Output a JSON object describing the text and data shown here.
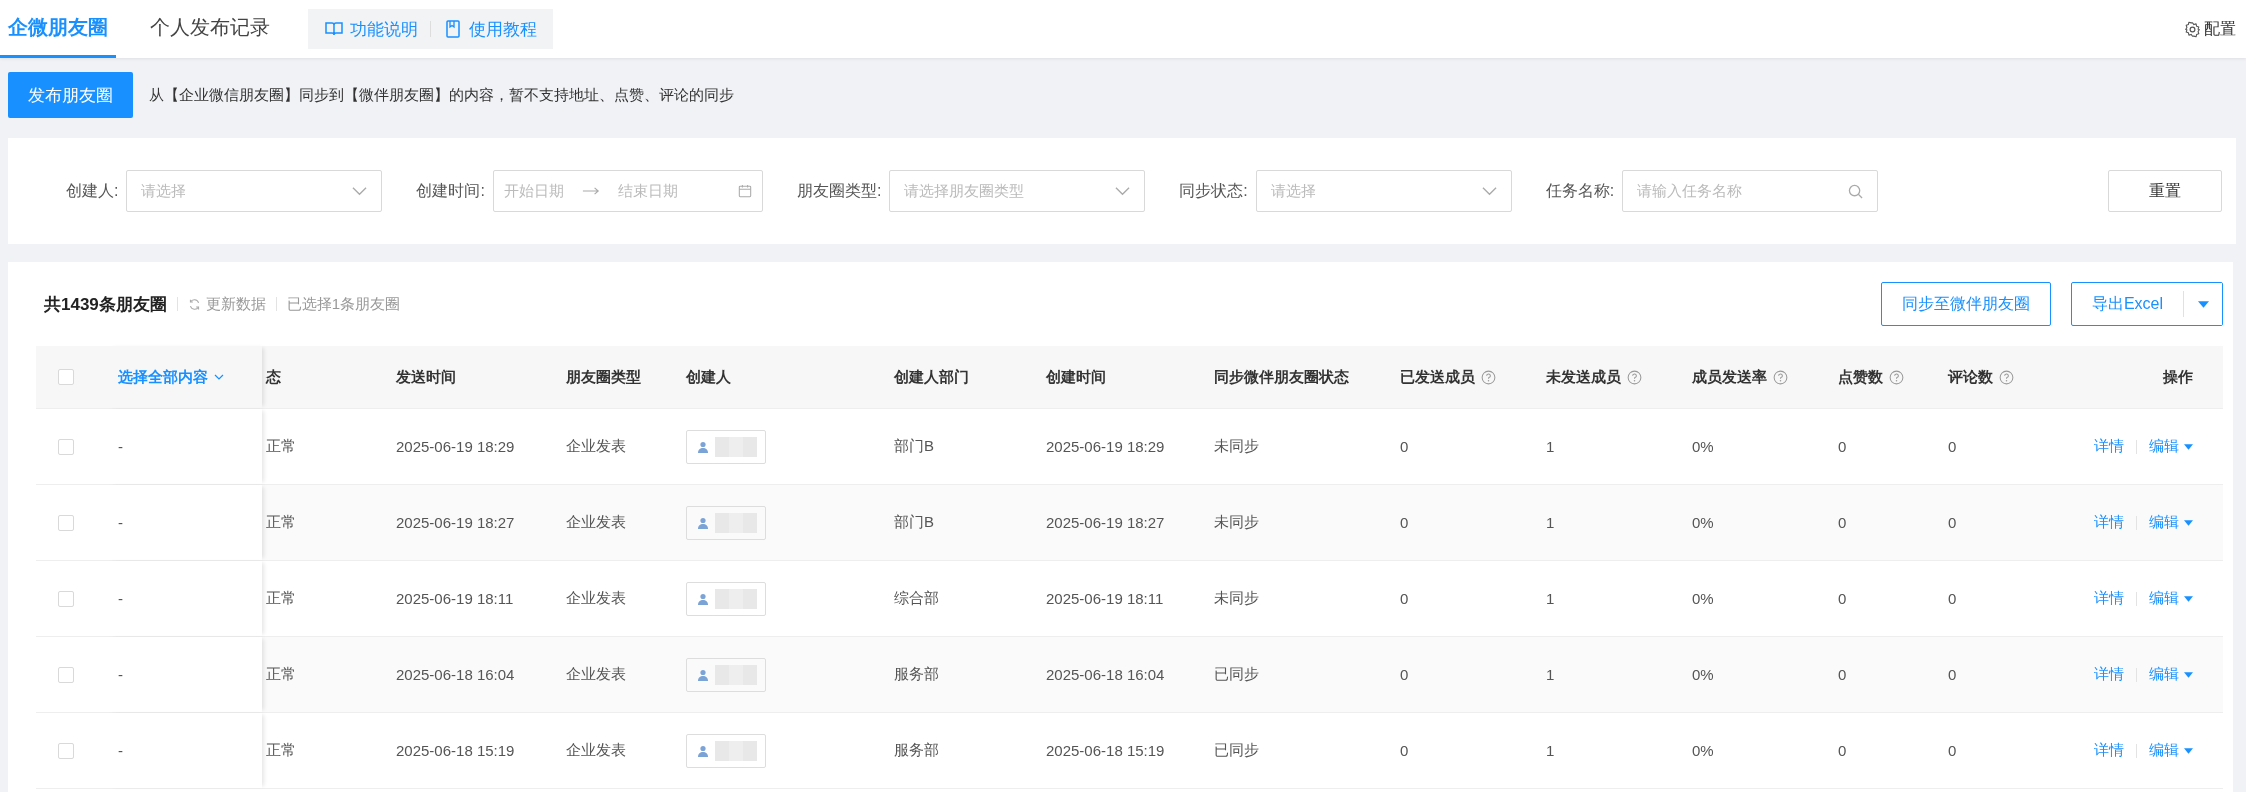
{
  "nav": {
    "tabs": [
      {
        "label": "企微朋友圈",
        "selected": true
      },
      {
        "label": "个人发布记录",
        "selected": false
      }
    ],
    "links": [
      {
        "kind": "book",
        "label": "功能说明"
      },
      {
        "kind": "doc",
        "label": "使用教程"
      }
    ],
    "config": "配置"
  },
  "toolbar": {
    "publish_button": "发布朋友圈",
    "notice": "从【企业微信朋友圈】同步到【微伴朋友圈】的内容，暂不支持地址、点赞、评论的同步"
  },
  "filters": [
    {
      "kind": "select",
      "label": "创建人:",
      "placeholder": "请选择"
    },
    {
      "kind": "daterange",
      "label": "创建时间:",
      "start": "开始日期",
      "end": "结束日期"
    },
    {
      "kind": "select",
      "label": "朋友圈类型:",
      "placeholder": "请选择朋友圈类型"
    },
    {
      "kind": "select",
      "label": "同步状态:",
      "placeholder": "请选择"
    },
    {
      "kind": "search",
      "label": "任务名称:",
      "placeholder": "请输入任务名称"
    }
  ],
  "reset_button": "重置",
  "summary": {
    "total": "共1439条朋友圈",
    "refresh": "更新数据",
    "selected_count": "已选择1条朋友圈"
  },
  "actions": {
    "sync_button": "同步至微伴朋友圈",
    "export_button": "导出Excel"
  },
  "table": {
    "select_all": "选择全部内容",
    "select_all_checked": false,
    "columns": [
      {
        "label": "态",
        "help": false
      },
      {
        "label": "发送时间",
        "help": false
      },
      {
        "label": "朋友圈类型",
        "help": false
      },
      {
        "label": "创建人",
        "help": false
      },
      {
        "label": "创建人部门",
        "help": false
      },
      {
        "label": "创建时间",
        "help": false
      },
      {
        "label": "同步微伴朋友圈状态",
        "help": false
      },
      {
        "label": "已发送成员",
        "help": true
      },
      {
        "label": "未发送成员",
        "help": true
      },
      {
        "label": "成员发送率",
        "help": true
      },
      {
        "label": "点赞数",
        "help": true
      },
      {
        "label": "评论数",
        "help": true
      },
      {
        "label": "操作",
        "help": false
      }
    ],
    "rows": [
      {
        "checked": false,
        "content": "-",
        "status": "正常",
        "sent_time": "2025-06-19 18:29",
        "type": "企业发表",
        "department": "部门B",
        "created_time": "2025-06-19 18:29",
        "sync_status": "未同步",
        "sent": "0",
        "unsent": "1",
        "rate": "0%",
        "likes": "0",
        "comments": "0",
        "detail": "详情",
        "edit": "编辑"
      },
      {
        "checked": false,
        "content": "-",
        "status": "正常",
        "sent_time": "2025-06-19 18:27",
        "type": "企业发表",
        "department": "部门B",
        "created_time": "2025-06-19 18:27",
        "sync_status": "未同步",
        "sent": "0",
        "unsent": "1",
        "rate": "0%",
        "likes": "0",
        "comments": "0",
        "detail": "详情",
        "edit": "编辑"
      },
      {
        "checked": false,
        "content": "-",
        "status": "正常",
        "sent_time": "2025-06-19 18:11",
        "type": "企业发表",
        "department": "综合部",
        "created_time": "2025-06-19 18:11",
        "sync_status": "未同步",
        "sent": "0",
        "unsent": "1",
        "rate": "0%",
        "likes": "0",
        "comments": "0",
        "detail": "详情",
        "edit": "编辑"
      },
      {
        "checked": false,
        "content": "-",
        "status": "正常",
        "sent_time": "2025-06-18 16:04",
        "type": "企业发表",
        "department": "服务部",
        "created_time": "2025-06-18 16:04",
        "sync_status": "已同步",
        "sent": "0",
        "unsent": "1",
        "rate": "0%",
        "likes": "0",
        "comments": "0",
        "detail": "详情",
        "edit": "编辑"
      },
      {
        "checked": false,
        "content": "-",
        "status": "正常",
        "sent_time": "2025-06-18 15:19",
        "type": "企业发表",
        "department": "服务部",
        "created_time": "2025-06-18 15:19",
        "sync_status": "已同步",
        "sent": "0",
        "unsent": "1",
        "rate": "0%",
        "likes": "0",
        "comments": "0",
        "detail": "详情",
        "edit": "编辑"
      }
    ]
  }
}
